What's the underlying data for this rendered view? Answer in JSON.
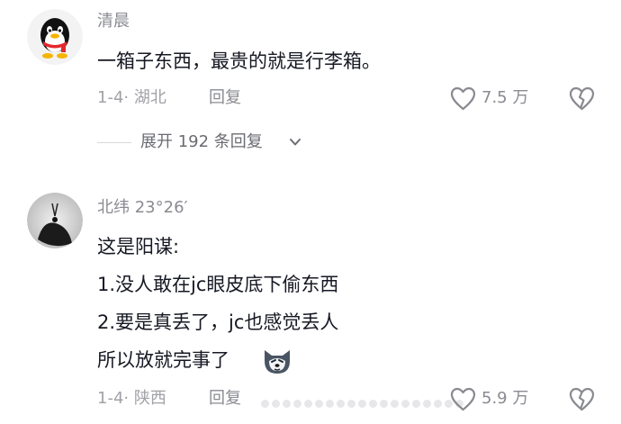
{
  "comments": [
    {
      "username": "清晨",
      "text_lines": [
        "一箱子东西，最贵的就是行李箱。"
      ],
      "meta": "1-4· 湖北",
      "reply_label": "回复",
      "like_count": "7.5 万",
      "expand_label": "展开 192 条回复"
    },
    {
      "username": "北纬 23°26′",
      "text_lines": [
        "这是阳谋:",
        "1.没人敢在jc眼皮底下偷东西",
        "2.要是真丢了，jc也感觉丢人",
        "所以放就完事了"
      ],
      "meta": "1-4· 陕西",
      "reply_label": "回复",
      "like_count": "5.9 万"
    }
  ],
  "icons": {
    "like": "heart-outline-icon",
    "dislike": "broken-heart-icon",
    "expand": "chevron-down-icon",
    "emoji": "husky-emoji-icon"
  }
}
